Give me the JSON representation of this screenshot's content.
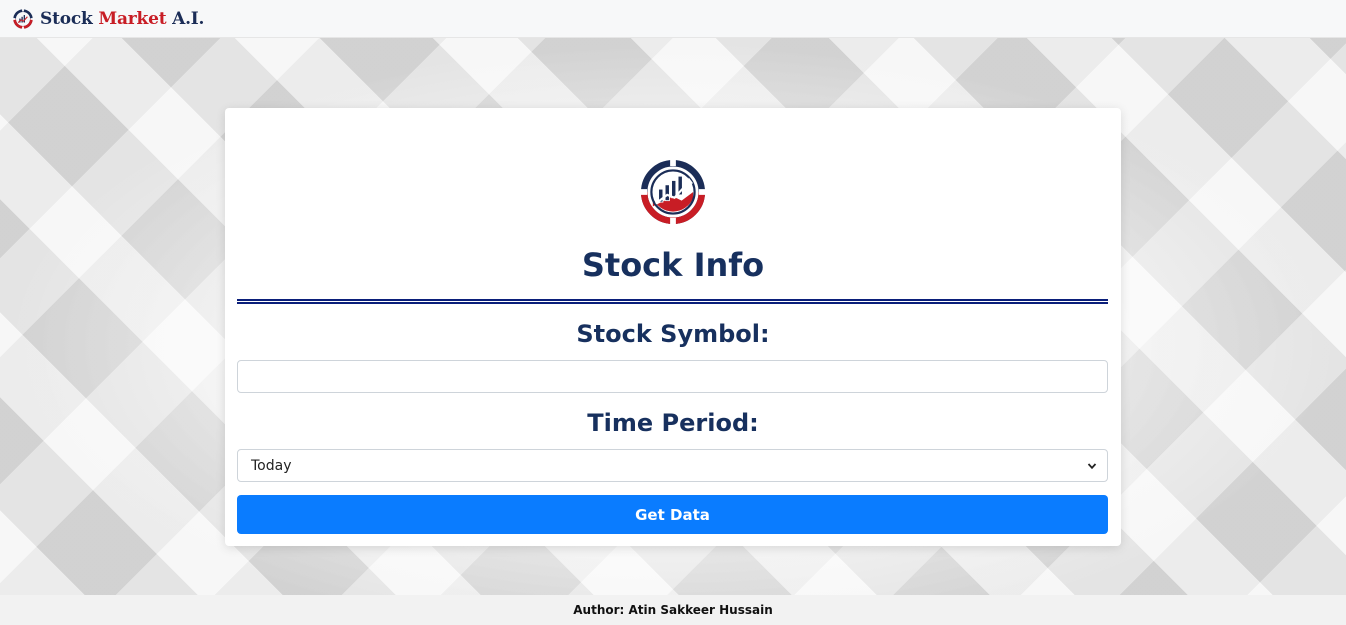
{
  "navbar": {
    "logo_icon": "stock-logo-icon",
    "brand_part1": "Stock",
    "brand_part2": "Market",
    "brand_part3": "A.I."
  },
  "card": {
    "logo_icon": "stock-logo-icon",
    "title": "Stock Info",
    "symbol_label": "Stock Symbol:",
    "symbol_value": "",
    "period_label": "Time Period:",
    "period_selected": "Today",
    "button_label": "Get Data"
  },
  "footer": {
    "text": "Author: Atin Sakkeer Hussain"
  },
  "colors": {
    "brand_navy": "#1b2d57",
    "brand_red": "#c81d25",
    "button_blue": "#0a7cff",
    "title_navy": "#17305e"
  }
}
